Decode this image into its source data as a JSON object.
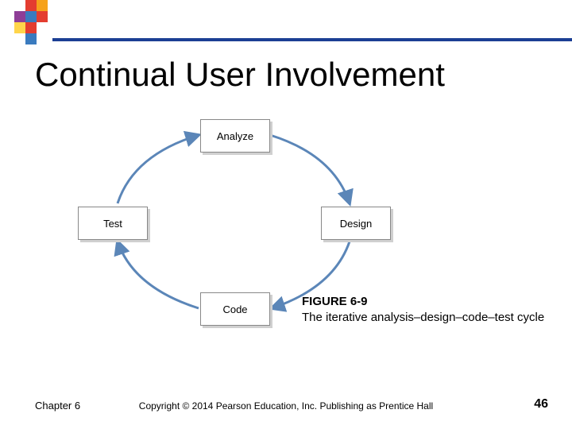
{
  "title": "Continual User Involvement",
  "diagram": {
    "nodes": {
      "analyze": "Analyze",
      "design": "Design",
      "code": "Code",
      "test": "Test"
    },
    "cycle_order": [
      "analyze",
      "design",
      "code",
      "test"
    ]
  },
  "caption": {
    "label": "FIGURE 6-9",
    "text": "The iterative analysis–design–code–test cycle"
  },
  "footer": {
    "chapter": "Chapter 6",
    "copyright": "Copyright © 2014 Pearson Education, Inc. Publishing as Prentice Hall",
    "page": "46"
  },
  "colors": {
    "accent_line": "#1c3f94",
    "arrow": "#5b86b8",
    "logo_palette": [
      "#e43d30",
      "#f6a21b",
      "#3a7bbf",
      "#8e3e97",
      "#ffd54a"
    ]
  }
}
